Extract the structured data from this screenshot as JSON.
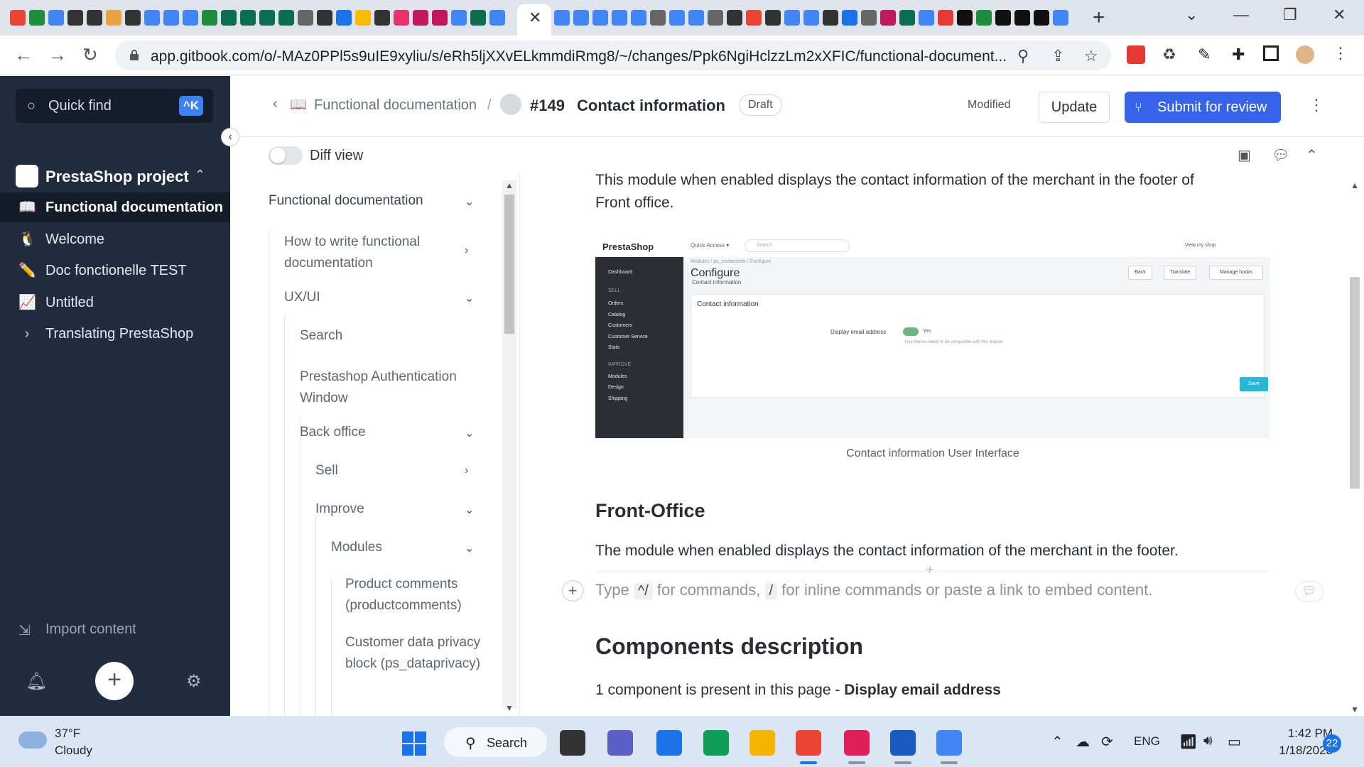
{
  "browser": {
    "tab_icon_colors": [
      "#ea4335",
      "#1e8e3e",
      "#4285f4",
      "#333333",
      "#333333",
      "#e8a33d",
      "#333333",
      "#4285f4",
      "#4285f4",
      "#4285f4",
      "#1e8e3e",
      "#0b6e4f",
      "#0b6e4f",
      "#0b6e4f",
      "#0b6e4f",
      "#666666",
      "#333333",
      "#1a73e8",
      "#fbbc05",
      "#333333",
      "#e8336d",
      "#c2185b",
      "#c2185b",
      "#4285f4",
      "#0b6e4f",
      "#4285f4"
    ],
    "tab_icon_colors_right": [
      "#4285f4",
      "#4285f4",
      "#4285f4",
      "#4285f4",
      "#4285f4",
      "#666666",
      "#4285f4",
      "#4285f4",
      "#666666",
      "#333333",
      "#ea4335",
      "#333333",
      "#4285f4",
      "#4285f4",
      "#333333",
      "#1a73e8",
      "#666666",
      "#c2185b",
      "#0b6e4f",
      "#4285f4",
      "#e53935",
      "#111111",
      "#1e8e3e",
      "#111111",
      "#111111",
      "#111111",
      "#4285f4"
    ],
    "active_tab_close": "✕",
    "new_tab": "+",
    "url": "app.gitbook.com/o/-MAz0PPl5s9uIE9xyliu/s/eRh5ljXXvELkmmdiRmg8/~/changes/Ppk6NgiHclzzLm2xXFIC/functional-document..."
  },
  "sidebar": {
    "quick_find": "Quick find",
    "shortcut": "^K",
    "space_name": "PrestaShop project",
    "items": [
      {
        "icon": "📖",
        "label": "Functional documentation",
        "active": true
      },
      {
        "icon": "🐧",
        "label": "Welcome"
      },
      {
        "icon": "✏️",
        "label": "Doc fonctionelle TEST"
      },
      {
        "icon": "📈",
        "label": "Untitled"
      },
      {
        "icon": "›",
        "label": "Translating PrestaShop"
      }
    ],
    "import": "Import content"
  },
  "header": {
    "breadcrumb": "Functional documentation",
    "cr_number": "#149",
    "cr_title": "Contact information",
    "badge": "Draft",
    "status": "Modified",
    "update_button": "Update",
    "submit_button": "Submit for review"
  },
  "toolbar": {
    "diff_label": "Diff view"
  },
  "tree": {
    "items": [
      {
        "label": "Functional documentation",
        "chev": "⌄"
      },
      {
        "label": "How to write functional documentation",
        "chev": "›"
      },
      {
        "label": "UX/UI",
        "chev": "⌄"
      },
      {
        "label": "Search",
        "chev": ""
      },
      {
        "label": "Prestashop Authentication Window",
        "chev": ""
      },
      {
        "label": "Back office",
        "chev": "⌄"
      },
      {
        "label": "Sell",
        "chev": "›"
      },
      {
        "label": "Improve",
        "chev": "⌄"
      },
      {
        "label": "Modules",
        "chev": "⌄"
      },
      {
        "label": "Product comments (productcomments)",
        "chev": ""
      },
      {
        "label": "Customer data privacy block (ps_dataprivacy)",
        "chev": ""
      }
    ]
  },
  "content": {
    "intro_line1": "This module when enabled displays the contact information of the merchant in the footer of",
    "intro_line2": "Front office.",
    "figure": {
      "logo": "PrestaShop",
      "quick_access": "Quick Access ▾",
      "search": "Search",
      "view_shop": "View my shop",
      "menu": [
        {
          "label": "Dashboard",
          "section": false
        },
        {
          "label": "SELL",
          "section": true
        },
        {
          "label": "Orders",
          "section": false
        },
        {
          "label": "Catalog",
          "section": false
        },
        {
          "label": "Customers",
          "section": false
        },
        {
          "label": "Customer Service",
          "section": false
        },
        {
          "label": "Stats",
          "section": false
        },
        {
          "label": "IMPROVE",
          "section": true
        },
        {
          "label": "Modules",
          "section": false
        },
        {
          "label": "Design",
          "section": false
        },
        {
          "label": "Shipping",
          "section": false
        }
      ],
      "crumb": "Modules / ps_contactinfo / Configure",
      "title": "Configure",
      "subtitle": "Contact information",
      "buttons": [
        "Back",
        "Translate",
        "Manage hooks"
      ],
      "panel_title": "Contact information",
      "field_label": "Display email address",
      "toggle_value": "Yes",
      "hint": "Your theme needs to be compatible with this feature",
      "save": "Save"
    },
    "caption": "Contact information User Interface",
    "h_front": "Front-Office",
    "front_text": "The module when enabled displays the contact information of the merchant in the footer.",
    "placeholder_type": "Type",
    "placeholder_k1": "^/",
    "placeholder_for": "for commands,",
    "placeholder_k2": "/",
    "placeholder_rest": "for inline commands or paste a link to embed content.",
    "h_components": "Components description",
    "components_text": "1 component is present in this page -",
    "components_bold": "Display email address"
  },
  "taskbar": {
    "temp": "37°F",
    "condition": "Cloudy",
    "search": "Search",
    "lang": "ENG",
    "time": "1:42 PM",
    "date": "1/18/2023",
    "notifications": "22",
    "app_colors": [
      "#333333",
      "#5b5fc7",
      "#1a73e8",
      "#0f9d58",
      "#f4b400",
      "#ea4335",
      "#e01e5a",
      "#185abd",
      "#4285f4"
    ]
  }
}
